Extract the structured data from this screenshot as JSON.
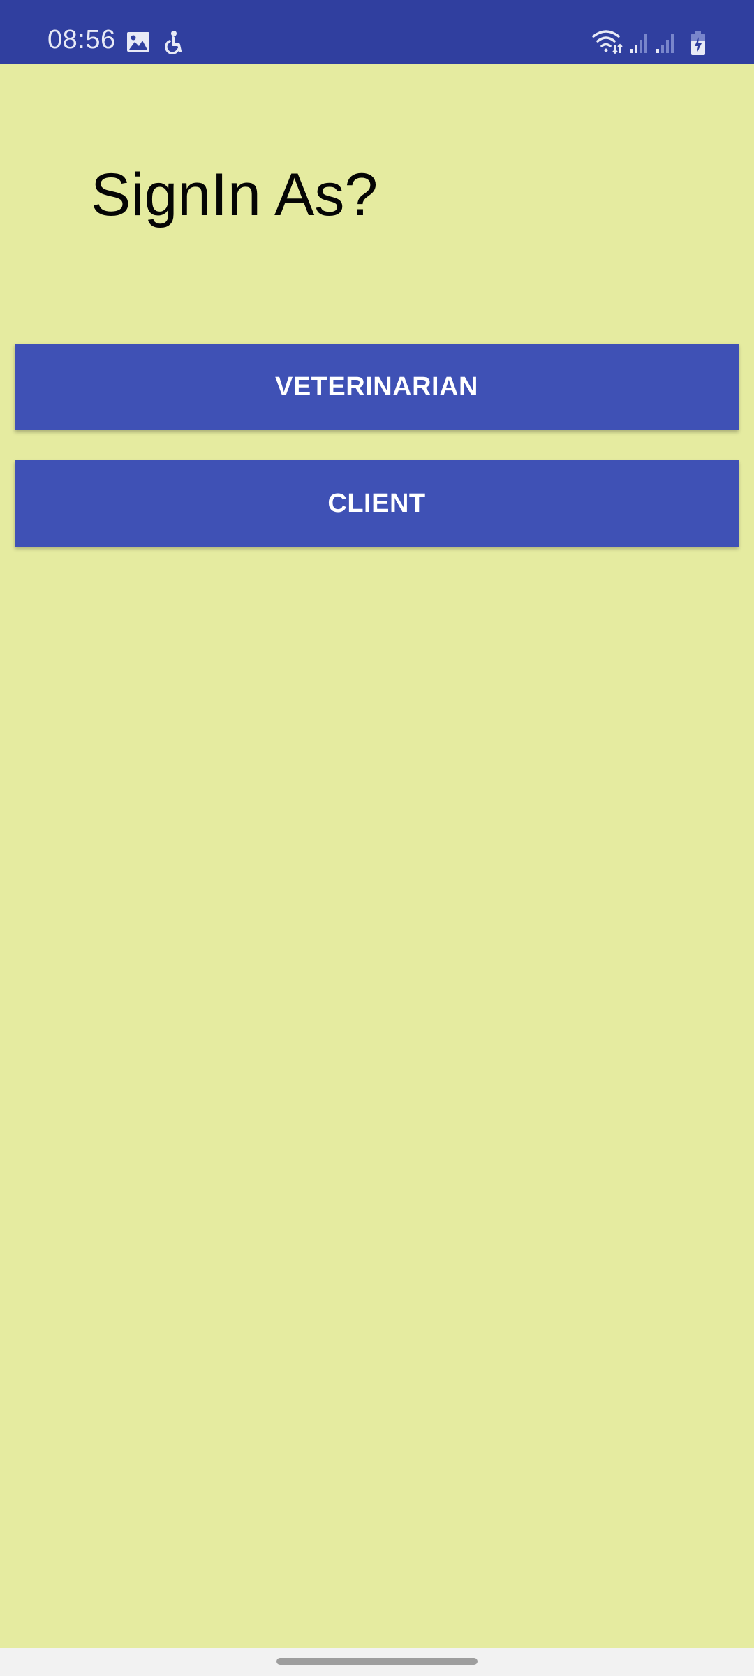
{
  "status_bar": {
    "time": "08:56",
    "background": "#303f9f",
    "left_icons": [
      "gallery-icon",
      "accessibility-icon"
    ],
    "right_icons": [
      "wifi-icon",
      "signal-icon",
      "signal-icon",
      "battery-charging-icon"
    ]
  },
  "screen": {
    "background": "#e5eba0",
    "title": "SignIn As?",
    "buttons": [
      {
        "label": "VETERINARIAN",
        "color": "#3f51b5"
      },
      {
        "label": "CLIENT",
        "color": "#3f51b5"
      }
    ]
  },
  "nav_bar": {
    "background": "#f2f2f2",
    "home_indicator": "home-indicator"
  }
}
